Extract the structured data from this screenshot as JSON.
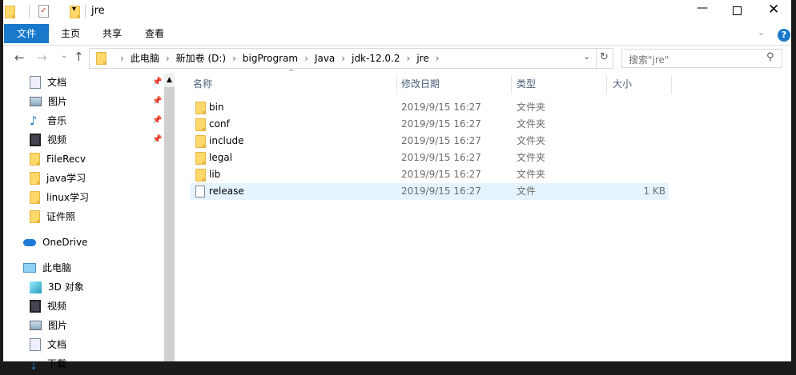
{
  "title": "jre",
  "ribbon": {
    "tabs": [
      "文件",
      "主页",
      "共享",
      "查看"
    ]
  },
  "address": {
    "crumbs": [
      "此电脑",
      "新加卷 (D:)",
      "bigProgram",
      "Java",
      "jdk-12.0.2",
      "jre"
    ],
    "search_placeholder": "搜索\"jre\""
  },
  "nav": {
    "quick": [
      {
        "label": "文档",
        "icon": "document-icon",
        "pinned": true
      },
      {
        "label": "图片",
        "icon": "picture-icon",
        "pinned": true
      },
      {
        "label": "音乐",
        "icon": "music-icon",
        "pinned": true
      },
      {
        "label": "视频",
        "icon": "video-icon",
        "pinned": true
      },
      {
        "label": "FileRecv",
        "icon": "folder-icon"
      },
      {
        "label": "java学习",
        "icon": "folder-icon"
      },
      {
        "label": "linux学习",
        "icon": "folder-icon"
      },
      {
        "label": "证件照",
        "icon": "folder-icon"
      }
    ],
    "onedrive": "OneDrive",
    "pc": "此电脑",
    "pc_items": [
      {
        "label": "3D 对象",
        "icon": "cube-icon"
      },
      {
        "label": "视频",
        "icon": "video-icon"
      },
      {
        "label": "图片",
        "icon": "picture-icon"
      },
      {
        "label": "文档",
        "icon": "document-icon"
      },
      {
        "label": "下载",
        "icon": "download-icon"
      }
    ]
  },
  "columns": [
    "名称",
    "修改日期",
    "类型",
    "大小"
  ],
  "files": [
    {
      "name": "bin",
      "date": "2019/9/15 16:27",
      "type": "文件夹",
      "size": "",
      "kind": "folder"
    },
    {
      "name": "conf",
      "date": "2019/9/15 16:27",
      "type": "文件夹",
      "size": "",
      "kind": "folder"
    },
    {
      "name": "include",
      "date": "2019/9/15 16:27",
      "type": "文件夹",
      "size": "",
      "kind": "folder"
    },
    {
      "name": "legal",
      "date": "2019/9/15 16:27",
      "type": "文件夹",
      "size": "",
      "kind": "folder"
    },
    {
      "name": "lib",
      "date": "2019/9/15 16:27",
      "type": "文件夹",
      "size": "",
      "kind": "folder"
    },
    {
      "name": "release",
      "date": "2019/9/15 16:27",
      "type": "文件",
      "size": "1 KB",
      "kind": "file"
    }
  ],
  "colors": {
    "accent": "#1979ca",
    "selected": "#e5f3ff"
  }
}
